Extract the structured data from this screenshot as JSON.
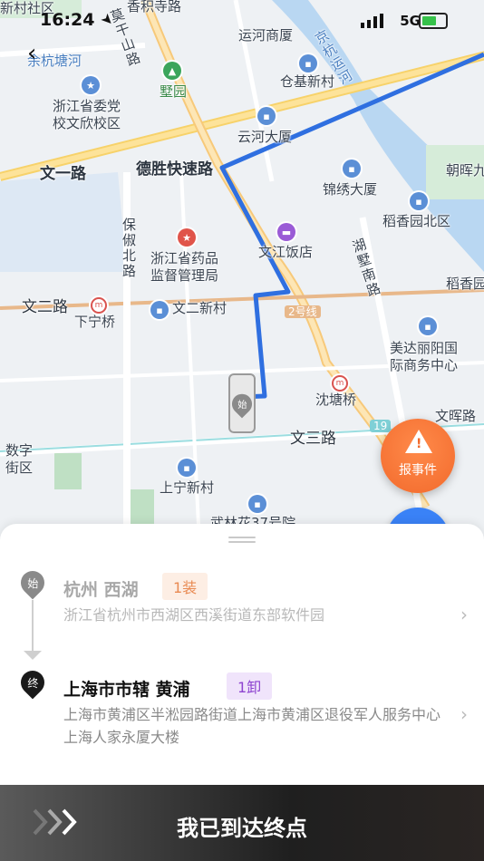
{
  "status_bar": {
    "time": "16:24",
    "network": "5G"
  },
  "map": {
    "labels": {
      "xincunshe": "新村社区",
      "xiangji_rd": "香积寺路",
      "yunhe_shangsha": "运河商厦",
      "moganshan_rd": "莫干山路",
      "yuhangtang_river": "余杭塘河",
      "jinghang_canal": "京杭运河",
      "party_school": "浙江省委党\n校文欣校区",
      "shuyuan": "墅园",
      "cangji_xincun": "仓基新村",
      "yunhe_dasha": "云河大厦",
      "chaohui": "朝晖九",
      "wenyi_rd": "文一路",
      "desheng_expy": "德胜快速路",
      "jinxiu_dasha": "锦绣大厦",
      "baochu_north": "保俶北路",
      "daoxiang_north": "稻香园北区",
      "drug_admin": "浙江省药品\n监督管理局",
      "wenjiang_hotel": "文江饭店",
      "hushu_south": "湖墅南路",
      "daoxiang": "稻香园",
      "wener_rd": "文二路",
      "wener_xincun": "文二新村",
      "line2": "2号线",
      "xianing_bridge": "下宁桥",
      "meida": "美达丽阳国\n际商务中心",
      "shentang_bridge": "沈塘桥",
      "wenhui_rd": "文晖路",
      "shuzi_street": "数字\n街区",
      "wensan_rd": "文三路",
      "shangning": "上宁新村",
      "wulin_partial": "武林花37号院",
      "line19": "19"
    }
  },
  "report_button": {
    "label": "报事件"
  },
  "start": {
    "pin_char": "始",
    "city": "杭州 西湖",
    "tag": "1装",
    "address": "浙江省杭州市西湖区西溪街道东部软件园"
  },
  "end": {
    "pin_char": "终",
    "city": "上海市市辖 黄浦",
    "tag": "1卸",
    "address": "上海市黄浦区半淞园路街道上海市黄浦区退役军人服务中心上海人家永厦大楼"
  },
  "arrive_button": {
    "label": "我已到达终点"
  },
  "truck_marker": {
    "char": "始"
  },
  "colors": {
    "route": "#2f6fe0",
    "accent_orange": "#f26a2c",
    "tag_orange_bg": "#fdeee4",
    "tag_purple_bg": "#f0e4fb"
  }
}
